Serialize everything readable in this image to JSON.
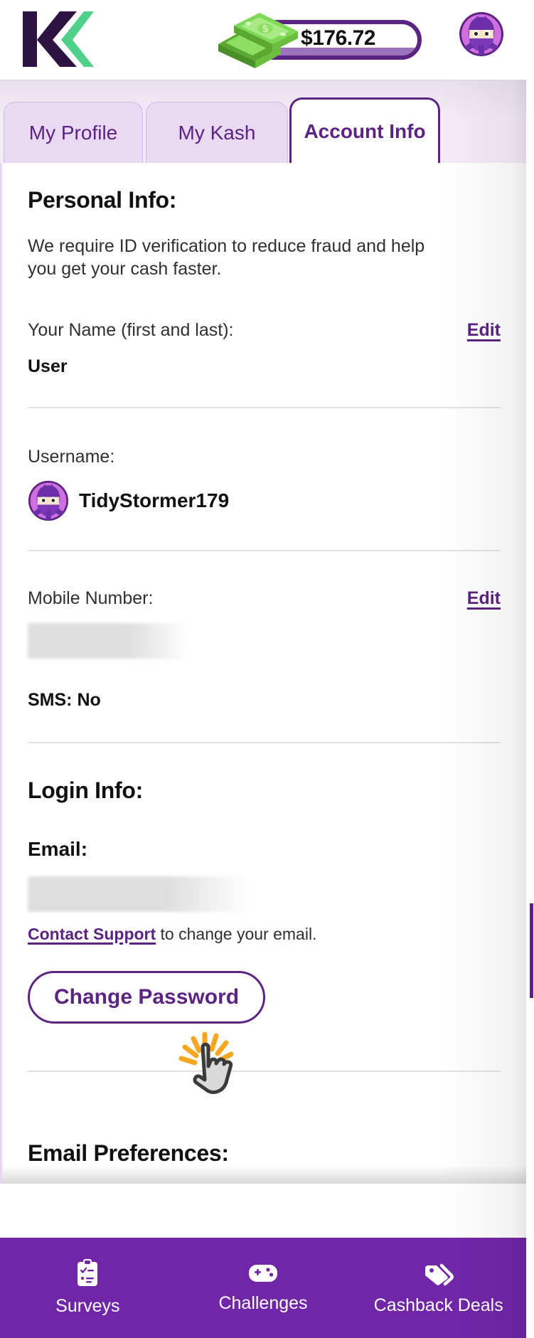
{
  "brand": {
    "logo_name": "kashkick-logo",
    "accent_purple": "#5b2382",
    "nav_purple": "#7126a8",
    "logo_green": "#4fd18b",
    "logo_dark": "#2e1340"
  },
  "header": {
    "balance": "$176.72",
    "cash_icon_name": "cash-stack-icon",
    "avatar_name": "ninja-avatar"
  },
  "tabs": [
    {
      "label": "My Profile",
      "active": false
    },
    {
      "label": "My Kash",
      "active": false
    },
    {
      "label": "Account Info",
      "active": true
    }
  ],
  "personal_info": {
    "heading": "Personal Info:",
    "blurb": "We require ID verification to reduce fraud and help you get your cash faster.",
    "name_label": "Your Name (first and last):",
    "name_value": "User",
    "name_edit": "Edit",
    "username_label": "Username:",
    "username_value": "TidyStormer179",
    "mobile_label": "Mobile Number:",
    "mobile_edit": "Edit",
    "mobile_value_redacted": "",
    "sms_line": "SMS: No"
  },
  "login_info": {
    "heading": "Login Info:",
    "email_label": "Email:",
    "email_value_redacted": "",
    "support_link": "Contact Support",
    "support_rest": " to change your email.",
    "change_password_label": "Change Password"
  },
  "email_preferences": {
    "heading": "Email Preferences:"
  },
  "bottom_nav": [
    {
      "label": "Surveys",
      "icon": "clipboard-checklist-icon"
    },
    {
      "label": "Challenges",
      "icon": "game-controller-icon"
    },
    {
      "label": "Cashback Deals",
      "icon": "price-tags-icon"
    }
  ],
  "cursor": {
    "name": "click-cursor-indicator"
  }
}
